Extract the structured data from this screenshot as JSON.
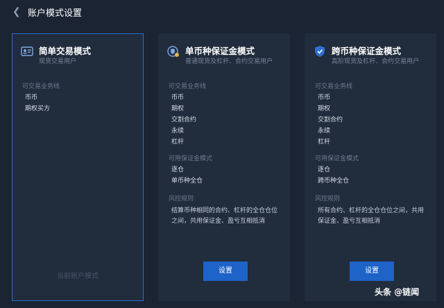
{
  "header": {
    "back_icon": "chevron-left-icon",
    "title": "账户模式设置"
  },
  "modes": [
    {
      "name": "简单交易模式",
      "subtitle": "现货交易用户",
      "icon": "id-card-icon",
      "business_label": "可交易业务线",
      "business_items": [
        "币币",
        "期权买方"
      ],
      "footer_text": "当前账户模式"
    },
    {
      "name": "单币种保证金模式",
      "subtitle": "普通现货及杠杆、合约交易用户",
      "icon": "coin-shield-icon",
      "business_label": "可交易业务线",
      "business_items": [
        "币币",
        "期权",
        "交割合约",
        "永续",
        "杠杆"
      ],
      "margin_label": "可用保证金模式",
      "margin_items": [
        "逐仓",
        "单币种全仓"
      ],
      "risk_label": "风控规则",
      "risk_text": "结算币种相同的合约、杠杆的全仓仓位之间，共用保证金、盈亏互相抵消",
      "button": "设置"
    },
    {
      "name": "跨币种保证金模式",
      "subtitle": "高阶现货及杠杆、合约交易用户",
      "icon": "shield-icon",
      "business_label": "可交易业务线",
      "business_items": [
        "币币",
        "期权",
        "交割合约",
        "永续",
        "杠杆"
      ],
      "margin_label": "可用保证金模式",
      "margin_items": [
        "逐仓",
        "跨币种全仓"
      ],
      "risk_label": "风控规则",
      "risk_text": "所有合约、杠杆的全仓仓位之间，共用保证金、盈亏互相抵消",
      "button": "设置"
    }
  ],
  "watermark": "头条 @链闻"
}
